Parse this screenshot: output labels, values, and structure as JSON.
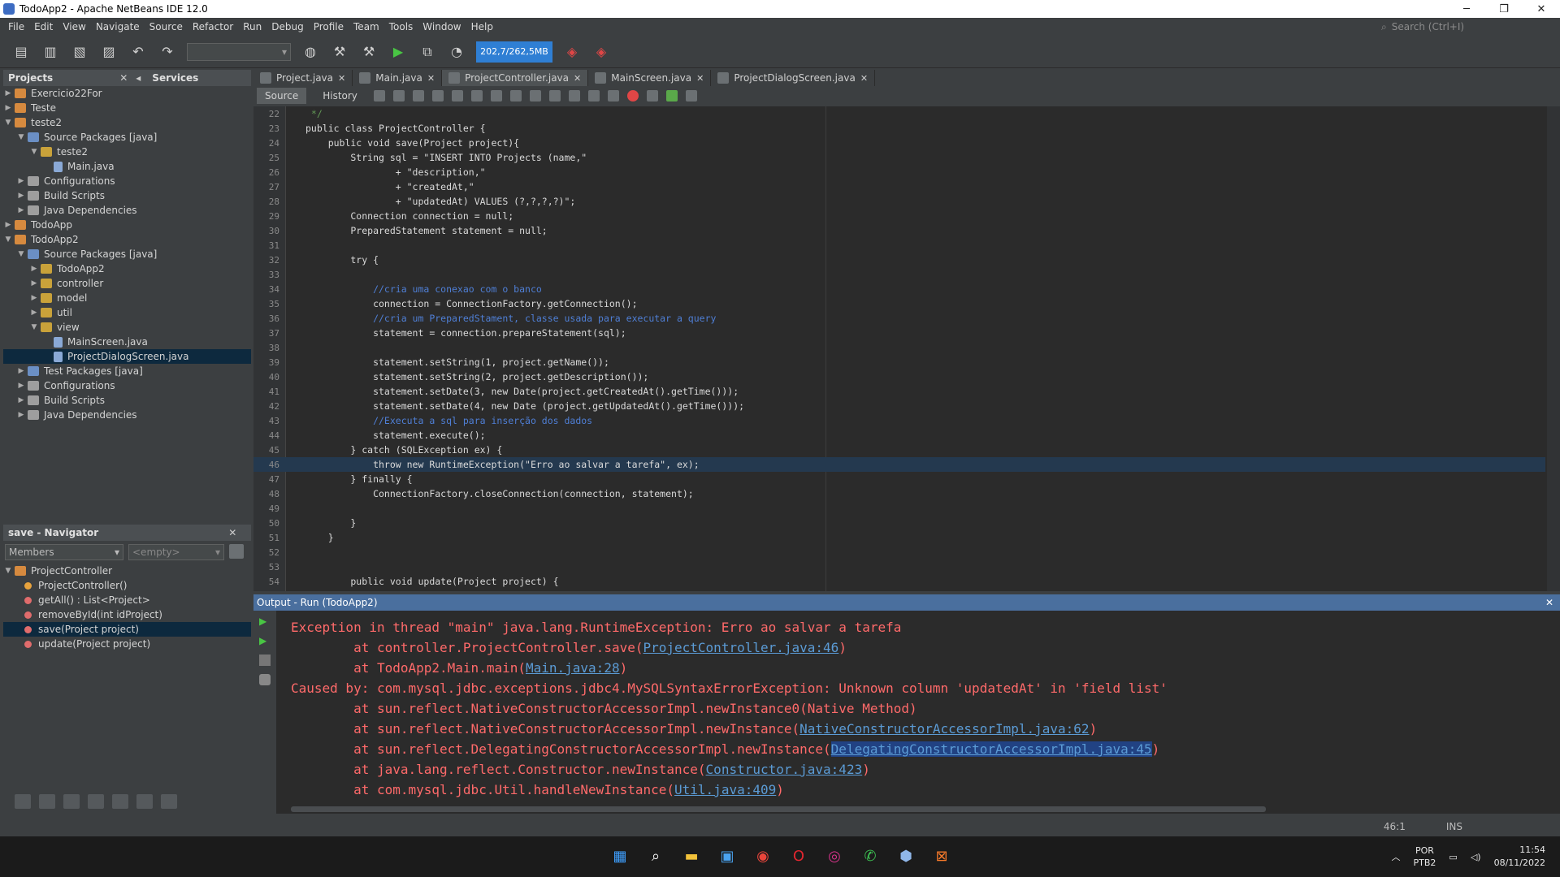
{
  "window": {
    "title": "TodoApp2 - Apache NetBeans IDE 12.0",
    "minimize": "─",
    "maximize": "❐",
    "close": "✕"
  },
  "menu": [
    "File",
    "Edit",
    "View",
    "Navigate",
    "Source",
    "Refactor",
    "Run",
    "Debug",
    "Profile",
    "Team",
    "Tools",
    "Window",
    "Help"
  ],
  "search": {
    "placeholder": "Search (Ctrl+I)"
  },
  "toolbar": {
    "memory": "202,7/262,5MB"
  },
  "projects": {
    "header": "Projects",
    "services": "Services",
    "nodes": [
      {
        "label": "Exercicio22For",
        "depth": 0,
        "arrow": "▶",
        "icon": "proj"
      },
      {
        "label": "Teste",
        "depth": 0,
        "arrow": "▶",
        "icon": "proj"
      },
      {
        "label": "teste2",
        "depth": 0,
        "arrow": "▼",
        "icon": "proj"
      },
      {
        "label": "Source Packages [java]",
        "depth": 1,
        "arrow": "▼",
        "icon": "src"
      },
      {
        "label": "teste2",
        "depth": 2,
        "arrow": "▼",
        "icon": "pkg"
      },
      {
        "label": "Main.java",
        "depth": 3,
        "arrow": "",
        "icon": "file"
      },
      {
        "label": "Configurations",
        "depth": 1,
        "arrow": "▶",
        "icon": "cfg"
      },
      {
        "label": "Build Scripts",
        "depth": 1,
        "arrow": "▶",
        "icon": "cfg"
      },
      {
        "label": "Java Dependencies",
        "depth": 1,
        "arrow": "▶",
        "icon": "cfg"
      },
      {
        "label": "TodoApp",
        "depth": 0,
        "arrow": "▶",
        "icon": "proj"
      },
      {
        "label": "TodoApp2",
        "depth": 0,
        "arrow": "▼",
        "icon": "proj"
      },
      {
        "label": "Source Packages [java]",
        "depth": 1,
        "arrow": "▼",
        "icon": "src"
      },
      {
        "label": "TodoApp2",
        "depth": 2,
        "arrow": "▶",
        "icon": "pkg"
      },
      {
        "label": "controller",
        "depth": 2,
        "arrow": "▶",
        "icon": "pkg"
      },
      {
        "label": "model",
        "depth": 2,
        "arrow": "▶",
        "icon": "pkg"
      },
      {
        "label": "util",
        "depth": 2,
        "arrow": "▶",
        "icon": "pkg"
      },
      {
        "label": "view",
        "depth": 2,
        "arrow": "▼",
        "icon": "pkg"
      },
      {
        "label": "MainScreen.java",
        "depth": 3,
        "arrow": "",
        "icon": "file"
      },
      {
        "label": "ProjectDialogScreen.java",
        "depth": 3,
        "arrow": "",
        "icon": "file",
        "selected": true
      },
      {
        "label": "Test Packages [java]",
        "depth": 1,
        "arrow": "▶",
        "icon": "src"
      },
      {
        "label": "Configurations",
        "depth": 1,
        "arrow": "▶",
        "icon": "cfg"
      },
      {
        "label": "Build Scripts",
        "depth": 1,
        "arrow": "▶",
        "icon": "cfg"
      },
      {
        "label": "Java Dependencies",
        "depth": 1,
        "arrow": "▶",
        "icon": "cfg"
      }
    ]
  },
  "navigator": {
    "header": "save - Navigator",
    "members": "Members",
    "filter": "<empty>",
    "root": "ProjectController",
    "items": [
      {
        "label": "ProjectController()",
        "color": "#e8a33d",
        "selected": false
      },
      {
        "label": "getAll() : List<Project>",
        "color": "#e06c6c",
        "selected": false
      },
      {
        "label": "removeById(int idProject)",
        "color": "#e06c6c",
        "selected": false
      },
      {
        "label": "save(Project project)",
        "color": "#e06c6c",
        "selected": true
      },
      {
        "label": "update(Project project)",
        "color": "#e06c6c",
        "selected": false
      }
    ]
  },
  "tabs": [
    {
      "label": "Project.java",
      "active": false
    },
    {
      "label": "Main.java",
      "active": false
    },
    {
      "label": "ProjectController.java",
      "active": true
    },
    {
      "label": "MainScreen.java",
      "active": false
    },
    {
      "label": "ProjectDialogScreen.java",
      "active": false
    }
  ],
  "editor": {
    "source_tab": "Source",
    "history_tab": "History",
    "current_line": 46,
    "lines": [
      {
        "no": "22",
        "code": " */",
        "color": "#629755"
      },
      {
        "no": "23",
        "code": "public class ProjectController {",
        "color": "#dadada"
      },
      {
        "no": "24",
        "code": "    public void save(Project project){",
        "color": "#dadada"
      },
      {
        "no": "25",
        "code": "        String sql = \"INSERT INTO Projects (name,\"",
        "color": "#dadada"
      },
      {
        "no": "26",
        "code": "                + \"description,\"",
        "color": "#dadada"
      },
      {
        "no": "27",
        "code": "                + \"createdAt,\"",
        "color": "#dadada"
      },
      {
        "no": "28",
        "code": "                + \"updatedAt) VALUES (?,?,?,?)\";",
        "color": "#dadada"
      },
      {
        "no": "29",
        "code": "        Connection connection = null;",
        "color": "#dadada"
      },
      {
        "no": "30",
        "code": "        PreparedStatement statement = null;",
        "color": "#dadada"
      },
      {
        "no": "31",
        "code": "",
        "color": "#dadada"
      },
      {
        "no": "32",
        "code": "        try {",
        "color": "#dadada"
      },
      {
        "no": "33",
        "code": "",
        "color": "#dadada"
      },
      {
        "no": "34",
        "code": "            //cria uma conexao com o banco",
        "color": "#4f7fd6"
      },
      {
        "no": "35",
        "code": "            connection = ConnectionFactory.getConnection();",
        "color": "#dadada"
      },
      {
        "no": "36",
        "code": "            //cria um PreparedStament, classe usada para executar a query",
        "color": "#4f7fd6"
      },
      {
        "no": "37",
        "code": "            statement = connection.prepareStatement(sql);",
        "color": "#dadada"
      },
      {
        "no": "38",
        "code": "",
        "color": "#dadada"
      },
      {
        "no": "39",
        "code": "            statement.setString(1, project.getName());",
        "color": "#dadada"
      },
      {
        "no": "40",
        "code": "            statement.setString(2, project.getDescription());",
        "color": "#dadada"
      },
      {
        "no": "41",
        "code": "            statement.setDate(3, new Date(project.getCreatedAt().getTime()));",
        "color": "#dadada"
      },
      {
        "no": "42",
        "code": "            statement.setDate(4, new Date (project.getUpdatedAt().getTime()));",
        "color": "#dadada"
      },
      {
        "no": "43",
        "code": "            //Executa a sql para inserção dos dados",
        "color": "#4f7fd6"
      },
      {
        "no": "44",
        "code": "            statement.execute();",
        "color": "#dadada"
      },
      {
        "no": "45",
        "code": "        } catch (SQLException ex) {",
        "color": "#dadada"
      },
      {
        "no": "46",
        "code": "            throw new RuntimeException(\"Erro ao salvar a tarefa\", ex);",
        "color": "#dadada"
      },
      {
        "no": "47",
        "code": "        } finally {",
        "color": "#dadada"
      },
      {
        "no": "48",
        "code": "            ConnectionFactory.closeConnection(connection, statement);",
        "color": "#dadada"
      },
      {
        "no": "49",
        "code": "",
        "color": "#dadada"
      },
      {
        "no": "50",
        "code": "        }",
        "color": "#dadada"
      },
      {
        "no": "51",
        "code": "    }",
        "color": "#dadada"
      },
      {
        "no": "52",
        "code": "",
        "color": "#dadada"
      },
      {
        "no": "53",
        "code": "",
        "color": "#dadada"
      },
      {
        "no": "54",
        "code": "        public void update(Project project) {",
        "color": "#dadada"
      }
    ]
  },
  "output": {
    "header": "Output - Run (TodoApp2)",
    "lines": [
      {
        "text": "Exception in thread \"main\" java.lang.RuntimeException: Erro ao salvar a tarefa",
        "link": "",
        "tail": ""
      },
      {
        "text": "        at controller.ProjectController.save(",
        "link": "ProjectController.java:46",
        "tail": ")"
      },
      {
        "text": "        at TodoApp2.Main.main(",
        "link": "Main.java:28",
        "tail": ")"
      },
      {
        "text": "Caused by: com.mysql.jdbc.exceptions.jdbc4.MySQLSyntaxErrorException: Unknown column 'updatedAt' in 'field list'",
        "link": "",
        "tail": ""
      },
      {
        "text": "        at sun.reflect.NativeConstructorAccessorImpl.newInstance0(Native Method)",
        "link": "",
        "tail": ""
      },
      {
        "text": "        at sun.reflect.NativeConstructorAccessorImpl.newInstance(",
        "link": "NativeConstructorAccessorImpl.java:62",
        "tail": ")"
      },
      {
        "text": "        at sun.reflect.DelegatingConstructorAccessorImpl.newInstance(",
        "link": "DelegatingConstructorAccessorImpl.java:45",
        "tail": ")",
        "highlight": true
      },
      {
        "text": "        at java.lang.reflect.Constructor.newInstance(",
        "link": "Constructor.java:423",
        "tail": ")"
      },
      {
        "text": "        at com.mysql.jdbc.Util.handleNewInstance(",
        "link": "Util.java:409",
        "tail": ")"
      }
    ]
  },
  "status": {
    "position": "46:1",
    "mode": "INS"
  },
  "taskbar": {
    "lang": "POR",
    "layout": "PTB2",
    "time": "11:54",
    "date": "08/11/2022",
    "apps": [
      {
        "name": "start-icon",
        "glyph": "▦",
        "color": "#3fa0ff"
      },
      {
        "name": "search-icon",
        "glyph": "⌕",
        "color": "#ffffff"
      },
      {
        "name": "file-explorer-icon",
        "glyph": "▬",
        "color": "#f2c23a"
      },
      {
        "name": "store-icon",
        "glyph": "▣",
        "color": "#4aa3f0"
      },
      {
        "name": "chrome-icon",
        "glyph": "◉",
        "color": "#e9453b"
      },
      {
        "name": "opera-icon",
        "glyph": "O",
        "color": "#e0262f"
      },
      {
        "name": "instagram-icon",
        "glyph": "◎",
        "color": "#d6338a"
      },
      {
        "name": "whatsapp-icon",
        "glyph": "✆",
        "color": "#3ec454"
      },
      {
        "name": "netbeans-icon",
        "glyph": "⬢",
        "color": "#8fb6e8"
      },
      {
        "name": "xampp-icon",
        "glyph": "⊠",
        "color": "#f5792a"
      }
    ]
  }
}
